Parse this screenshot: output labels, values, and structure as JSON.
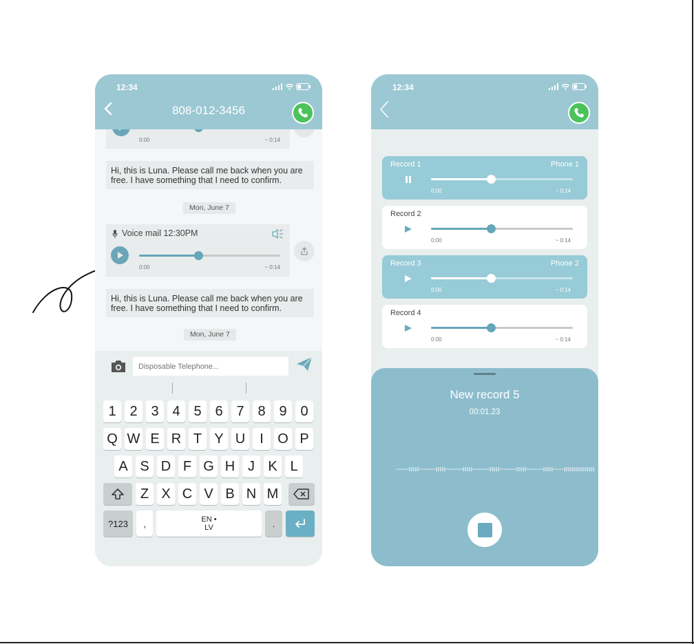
{
  "colors": {
    "header": "#9cc8d4",
    "accent": "#65a6b9",
    "call_green": "#4cc35a",
    "highlight": "#97cbd7",
    "sheet": "#8dbdcd"
  },
  "left_phone": {
    "status_time": "12:34",
    "title": "808-012-3456",
    "voicemail_top": {
      "time_start": "0:00",
      "time_end": "~ 0:14"
    },
    "messages": [
      {
        "text": "Hi, this is Luna. Please call me back when you are free. I have something that I need to confirm."
      },
      {
        "text": "Hi, this is Luna. Please call me back when you are free. I have something that I need to confirm."
      }
    ],
    "dates": [
      "Mon, June 7",
      "Mon, June 7"
    ],
    "voicemail": {
      "title": "Voice mail 12:30PM",
      "time_start": "0:00",
      "time_end": "~ 0:14",
      "progress": 0.42
    },
    "input_placeholder": "Disposable Telephone...",
    "keyboard": {
      "row_numbers": [
        "1",
        "2",
        "3",
        "4",
        "5",
        "6",
        "7",
        "8",
        "9",
        "0"
      ],
      "row_q": [
        "Q",
        "W",
        "E",
        "R",
        "T",
        "Y",
        "U",
        "I",
        "O",
        "P"
      ],
      "row_a": [
        "A",
        "S",
        "D",
        "F",
        "G",
        "H",
        "J",
        "K",
        "L"
      ],
      "row_z": [
        "Z",
        "X",
        "C",
        "V",
        "B",
        "N",
        "M"
      ],
      "sym_label": "?123",
      "comma": ",",
      "space_label_1": "EN •",
      "space_label_2": "LV",
      "period": "."
    }
  },
  "right_phone": {
    "status_time": "12:34",
    "records": [
      {
        "name": "Record 1",
        "phone": "Phone 1",
        "time_start": "0:00",
        "time_end": "~ 0:14",
        "progress": 0.42,
        "state": "playing"
      },
      {
        "name": "Record 2",
        "phone": "",
        "time_start": "0:00",
        "time_end": "~ 0:14",
        "progress": 0.42,
        "state": "paused"
      },
      {
        "name": "Record 3",
        "phone": "Phone 2",
        "time_start": "0:00",
        "time_end": "~ 0:14",
        "progress": 0.42,
        "state": "paused"
      },
      {
        "name": "Record 4",
        "phone": "",
        "time_start": "0:00",
        "time_end": "~ 0:14",
        "progress": 0.42,
        "state": "paused"
      }
    ],
    "new_record": {
      "title": "New record 5",
      "elapsed": "00:01.23"
    }
  },
  "icons": [
    "back-icon",
    "phone-icon",
    "signal-icon",
    "wifi-icon",
    "battery-icon",
    "microphone-icon",
    "speaker-icon",
    "play-icon",
    "pause-icon",
    "share-icon",
    "camera-icon",
    "send-icon",
    "shift-icon",
    "backspace-icon",
    "enter-icon",
    "stop-icon"
  ]
}
